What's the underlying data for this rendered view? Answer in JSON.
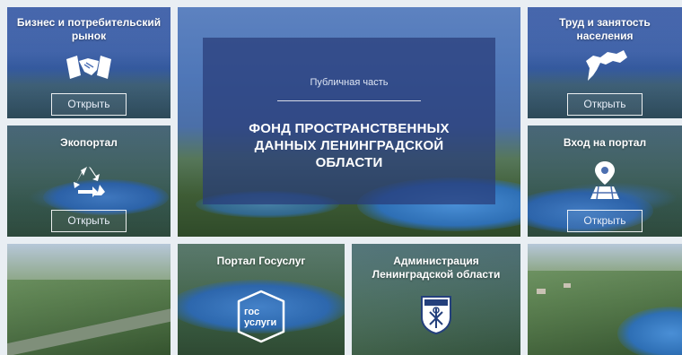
{
  "tiles": {
    "business": {
      "title": "Бизнес и потребительский рынок",
      "button": "Открыть",
      "icon": "handshake-icon"
    },
    "labor": {
      "title": "Труд и занятость населения",
      "button": "Открыть",
      "icon": "region-map-icon"
    },
    "eco": {
      "title": "Экопортал",
      "button": "Открыть",
      "icon": "recycle-icon"
    },
    "portal": {
      "title": "Вход на портал",
      "button": "Открыть",
      "icon": "map-pin-icon"
    },
    "gosuslugi": {
      "title": "Портал Госуслуг",
      "logo_line1": "гос",
      "logo_line2": "услуги",
      "icon": "gosuslugi-logo"
    },
    "admin": {
      "title": "Администрация Ленинградской области",
      "icon": "coat-of-arms-icon"
    }
  },
  "center": {
    "subtitle": "Публичная часть",
    "title": "ФОНД ПРОСТРАНСТВЕННЫХ ДАННЫХ ЛЕНИНГРАДСКОЙ ОБЛАСТИ"
  },
  "colors": {
    "overlay_blue": "#3d5aa8",
    "button_border": "#ffffff"
  }
}
